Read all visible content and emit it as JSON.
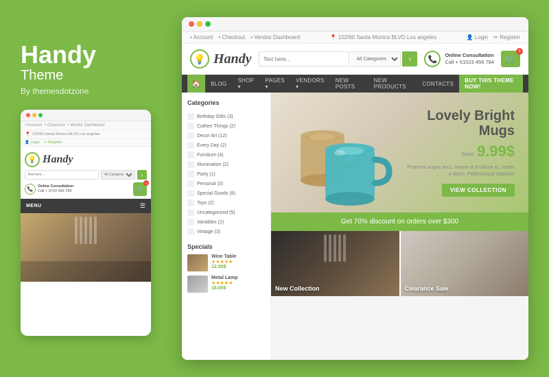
{
  "left": {
    "title": "Handy",
    "subtitle": "Theme",
    "by_line": "By themesdotzone"
  },
  "mobile": {
    "dots": [
      "red",
      "yellow",
      "green"
    ],
    "nav_links": [
      "• Account",
      "• Checkout",
      "• Vendor Dashboard"
    ],
    "address": "102/60 Santa Monica BLVD Los angeles",
    "login_links": [
      "Login",
      "Register"
    ],
    "logo_text": "Handy",
    "search_placeholder": "Text here...",
    "search_select": "All Categories",
    "consult_title": "Online Consultation",
    "phone": "Call + 0723 456 789",
    "cart_count": "0",
    "menu_label": "MENU"
  },
  "desktop": {
    "dots": [
      "red",
      "yellow",
      "green"
    ],
    "top_nav": [
      "• Account",
      "• Checkout",
      "• Vendor Dashboard"
    ],
    "top_address": "102/60 Santa Monica BLVD Los angeles",
    "top_right": [
      "Login",
      "Register"
    ],
    "logo_text": "Handy",
    "search_placeholder": "Text here...",
    "search_select": "All Categories",
    "consult_title": "Online Consultation",
    "phone": "Call + 01023 456 784",
    "cart_count": "0",
    "nav_items": [
      "BLOG",
      "SHOP ▾",
      "PAGES ▾",
      "VENDORS ▾",
      "NEW POSTS",
      "NEW PRODUCTS",
      "CONTACTS"
    ],
    "nav_buy": "BUY THIS THEME NOW!",
    "hero": {
      "title": "Lovely Bright\nMugs",
      "from_label": "from",
      "price": "9.99$",
      "description": "Praesent augue arcu, ornare ut tincidunt ac, mattis a libero. Pellentesque habitant.",
      "btn_label": "VIEW COLLECTION"
    },
    "promo_banner": "Get 70% discount on orders over $300",
    "bottom_images": [
      {
        "label": "New Collection"
      },
      {
        "label": "Clearance Sale"
      }
    ],
    "sidebar": {
      "categories_title": "Categories",
      "categories": [
        "Birthday Gifts (3)",
        "Cothen Things (2)",
        "Decor Art (12)",
        "Every Day (2)",
        "Furniture (4)",
        "Illumination (2)",
        "Party (1)",
        "Personal (3)",
        "Special Goods (8)",
        "Toys (2)",
        "Uncategorized (5)",
        "Variables (2)",
        "Vintage (3)"
      ],
      "specials_title": "Specials",
      "specials": [
        {
          "name": "Wine Table",
          "stars": "★★★★★",
          "price": "12.00$",
          "old_price": ""
        },
        {
          "name": "Metal Lamp",
          "stars": "★★★★★",
          "price": "18.00$",
          "old_price": ""
        }
      ]
    }
  }
}
